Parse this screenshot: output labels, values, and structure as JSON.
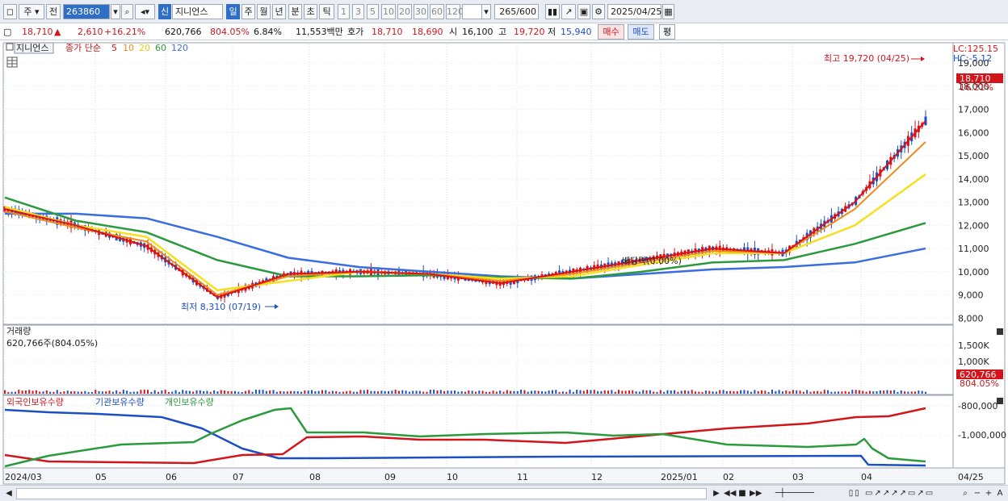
{
  "toolbar": {
    "type_label": "주",
    "type2_label": "전",
    "code_value": "263860",
    "badge_new": "신",
    "stock_name": "지니언스",
    "periods": [
      "일",
      "주",
      "월",
      "년",
      "분",
      "초",
      "틱"
    ],
    "intervals": [
      "1",
      "3",
      "5",
      "10",
      "20",
      "30",
      "60",
      "120"
    ],
    "count_value": "265",
    "count_total": "/600",
    "date_value": "2025/04/25"
  },
  "quote": {
    "price": "18,710",
    "change_icon": "▲",
    "change": "2,610",
    "change_pct": "+16.21%",
    "volume": "620,766",
    "volume_pct": "804.05%",
    "turnover": "6.84%",
    "amount": "11,553백만",
    "bidask_label": "호가",
    "ask": "18,710",
    "bid": "18,690",
    "open_label": "시",
    "open": "16,100",
    "high_label": "고",
    "high": "19,720",
    "low_label": "저",
    "low": "15,940",
    "buy_button": "매수",
    "sell_button": "매도",
    "eval_button": "평"
  },
  "price_panel": {
    "name_tag": "지니언스",
    "ma_label": "종가 단순",
    "ma_periods": [
      "5",
      "10",
      "20",
      "60",
      "120"
    ],
    "lc_label": "LC:125.15",
    "hc_label": "HC:-5.12",
    "high_annotation": "최고 19,720 (04/25)",
    "low_annotation": "최저 8,310 (07/19)",
    "dividend_annotation": "배당락(0.00%)",
    "y_ticks": [
      "19,000",
      "18,000",
      "17,000",
      "16,000",
      "15,000",
      "14,000",
      "13,000",
      "12,000",
      "11,000",
      "10,000",
      "9,000",
      "8,000"
    ],
    "current_price_tag": "18,710",
    "current_pct_tag": "16.21%"
  },
  "volume_panel": {
    "title": "거래량",
    "value_label": "620,766주(804.05%)",
    "y_ticks": [
      "1,500K",
      "1,000K"
    ],
    "current_tag": "620,766",
    "current_pct_tag": "804.05%"
  },
  "holding_panel": {
    "foreign_label": "외국인보유수량",
    "inst_label": "기관보유수량",
    "indiv_label": "개인보유수량",
    "y_ticks": [
      "-800,000",
      "-1,000,000"
    ]
  },
  "x_axis": {
    "labels": [
      "2024/03",
      "05",
      "06",
      "07",
      "08",
      "09",
      "10",
      "11",
      "12",
      "2025/01",
      "02",
      "03",
      "04",
      "04/25"
    ]
  },
  "colors": {
    "up": "#d4141b",
    "down": "#1c4fc4",
    "ma5": "#e01010",
    "ma10": "#f08a1a",
    "ma20": "#f5e020",
    "ma60": "#2a9a3c",
    "ma120": "#3a6ee0",
    "accent": "#2f6ec7"
  },
  "chart_data": {
    "type": "line",
    "title": "지니언스",
    "x": [
      "2024/03",
      "05",
      "06",
      "07",
      "08",
      "09",
      "10",
      "11",
      "12",
      "2025/01",
      "02",
      "03",
      "04",
      "04/25"
    ],
    "series": [
      {
        "name": "5",
        "values": [
          12700,
          12000,
          11100,
          8900,
          9900,
          10000,
          9900,
          9500,
          10000,
          10500,
          11000,
          10800,
          13000,
          16500
        ]
      },
      {
        "name": "10",
        "values": [
          12600,
          11900,
          11300,
          9000,
          9800,
          10000,
          9900,
          9600,
          9900,
          10400,
          10900,
          10800,
          12700,
          15600
        ]
      },
      {
        "name": "20",
        "values": [
          12800,
          12000,
          11500,
          9200,
          9600,
          10000,
          9900,
          9700,
          9800,
          10300,
          10800,
          10800,
          12000,
          14200
        ]
      },
      {
        "name": "60",
        "values": [
          13200,
          12200,
          11700,
          10500,
          9800,
          9800,
          9850,
          9750,
          9700,
          10000,
          10400,
          10500,
          11200,
          12100
        ]
      },
      {
        "name": "120",
        "values": [
          12500,
          12500,
          12300,
          11500,
          10600,
          10200,
          10000,
          9800,
          9700,
          9900,
          10100,
          10200,
          10400,
          11000
        ]
      }
    ],
    "ylim": [
      7800,
      19800
    ]
  }
}
